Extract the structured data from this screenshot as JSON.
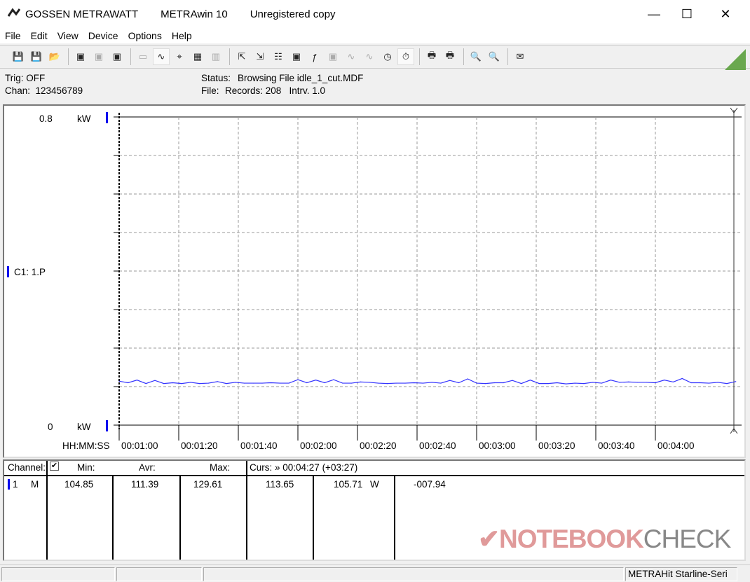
{
  "titlebar": {
    "app": "GOSSEN METRAWATT",
    "product": "METRAwin 10",
    "license": "Unregistered copy",
    "minimize": "—",
    "maximize": "☐",
    "close": "✕"
  },
  "menu": [
    "File",
    "Edit",
    "View",
    "Device",
    "Options",
    "Help"
  ],
  "toolbar": {
    "icons": [
      "save-icon",
      "save-as-icon",
      "open-folder-icon",
      "sep",
      "device-read-icon",
      "device-disabled-icon",
      "memory-icon",
      "sep",
      "display-icon",
      "waveform-icon",
      "crosshair-icon",
      "table-icon",
      "bar-chart-icon",
      "sep",
      "export-icon",
      "import-icon",
      "settings-icon",
      "monitor-icon",
      "formula-icon",
      "meter-icon",
      "signal-icon",
      "multi-signal-icon",
      "clock-icon",
      "timer-icon",
      "sep",
      "print-preview-icon",
      "print-icon",
      "sep",
      "zoom-wave-icon",
      "zoom-signal-icon",
      "sep",
      "help-icon"
    ],
    "glyphs": [
      "💾",
      "💾",
      "📂",
      "",
      "▣",
      "▣",
      "▣",
      "",
      "▭",
      "∿",
      "⌖",
      "▦",
      "▥",
      "",
      "⇱",
      "⇲",
      "☷",
      "▣",
      "ƒ",
      "▣",
      "∿",
      "∿",
      "◷",
      "⏱",
      "",
      "🖶",
      "🖶",
      "",
      "🔍",
      "🔍",
      "",
      "✉"
    ],
    "active": [
      9,
      23
    ],
    "disabled": [
      5,
      8,
      12,
      19,
      20,
      21
    ]
  },
  "info": {
    "trig": "Trig: OFF",
    "chan": "Chan:  123456789",
    "status_label": "Status:",
    "status_value": "Browsing File idle_1_cut.MDF",
    "file_label": "File:",
    "file_value": "Records: 208   Intrv. 1.0"
  },
  "chart_data": {
    "type": "line",
    "channel_label": "C1: 1.P",
    "y_top_label": "0.8",
    "y_bottom_label": "0",
    "y_unit": "kW",
    "ylim": [
      0,
      0.8
    ],
    "xlabel": "HH:MM:SS",
    "x_ticks": [
      "00:01:00",
      "00:01:20",
      "00:01:40",
      "00:02:00",
      "00:02:20",
      "00:02:40",
      "00:03:00",
      "00:03:20",
      "00:03:40",
      "00:04:00"
    ],
    "xlim": [
      "00:01:00",
      "00:04:27"
    ],
    "grid": true,
    "line_color": "#3333ff",
    "x": [
      "00:01:00",
      "00:01:03",
      "00:01:06",
      "00:01:09",
      "00:01:12",
      "00:01:15",
      "00:01:18",
      "00:01:21",
      "00:01:24",
      "00:01:27",
      "00:01:30",
      "00:01:33",
      "00:01:36",
      "00:01:39",
      "00:01:42",
      "00:01:45",
      "00:01:48",
      "00:01:51",
      "00:01:54",
      "00:01:57",
      "00:02:00",
      "00:02:03",
      "00:02:06",
      "00:02:09",
      "00:02:12",
      "00:02:15",
      "00:02:18",
      "00:02:21",
      "00:02:24",
      "00:02:27",
      "00:02:30",
      "00:02:33",
      "00:02:36",
      "00:02:39",
      "00:02:42",
      "00:02:45",
      "00:02:48",
      "00:02:51",
      "00:02:54",
      "00:02:57",
      "00:03:00",
      "00:03:03",
      "00:03:06",
      "00:03:09",
      "00:03:12",
      "00:03:15",
      "00:03:18",
      "00:03:21",
      "00:03:24",
      "00:03:27",
      "00:03:30",
      "00:03:33",
      "00:03:36",
      "00:03:39",
      "00:03:42",
      "00:03:45",
      "00:03:48",
      "00:03:51",
      "00:03:54",
      "00:03:57",
      "00:04:00",
      "00:04:03",
      "00:04:06",
      "00:04:09",
      "00:04:12",
      "00:04:15",
      "00:04:18",
      "00:04:21",
      "00:04:24",
      "00:04:27"
    ],
    "values": [
      0.114,
      0.11,
      0.117,
      0.108,
      0.116,
      0.108,
      0.11,
      0.108,
      0.111,
      0.108,
      0.109,
      0.113,
      0.108,
      0.111,
      0.109,
      0.109,
      0.109,
      0.11,
      0.109,
      0.109,
      0.118,
      0.11,
      0.117,
      0.11,
      0.118,
      0.109,
      0.109,
      0.112,
      0.111,
      0.109,
      0.108,
      0.109,
      0.109,
      0.11,
      0.109,
      0.111,
      0.109,
      0.116,
      0.11,
      0.12,
      0.109,
      0.108,
      0.11,
      0.11,
      0.116,
      0.108,
      0.117,
      0.108,
      0.108,
      0.11,
      0.107,
      0.109,
      0.108,
      0.111,
      0.109,
      0.117,
      0.111,
      0.112,
      0.111,
      0.111,
      0.11,
      0.117,
      0.112,
      0.121,
      0.11,
      0.11,
      0.109,
      0.111,
      0.108,
      0.113
    ]
  },
  "table": {
    "headers": {
      "channel": "Channel:",
      "min": "Min:",
      "avr": "Avr:",
      "max": "Max:",
      "curs": "Curs: » 00:04:27 (+03:27)"
    },
    "rows": [
      {
        "channel": "1",
        "mode": "M",
        "min": "104.85",
        "avr": "111.39",
        "max": "129.61",
        "curs1": "113.65",
        "curs2": "105.71",
        "unit": "W",
        "diff": "-007.94",
        "checked": true
      }
    ]
  },
  "statusbar": {
    "device": "METRAHit Starline-Seri"
  },
  "watermark": "NOTEBOOKCHECK"
}
